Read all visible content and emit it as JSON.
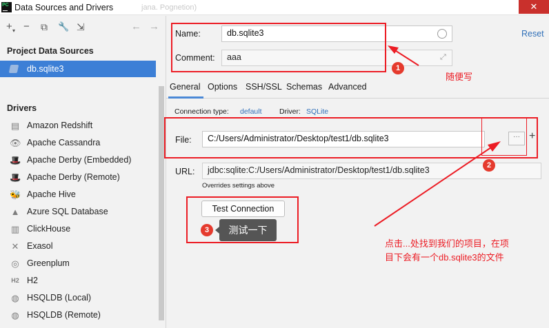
{
  "window": {
    "title": "Data Sources and Drivers",
    "ghost_text": "jana. Pognetion)",
    "close_glyph": "✕",
    "logo_text": "PC"
  },
  "toolbar": {
    "add": "+",
    "add_caret": "▾",
    "remove": "−",
    "copy": "⧉",
    "settings": "🔧",
    "import": "⇲",
    "back": "←",
    "forward": "→"
  },
  "left": {
    "project_header": "Project Data Sources",
    "project_item": "db.sqlite3",
    "drivers_header": "Drivers",
    "drivers": [
      {
        "label": "Amazon Redshift",
        "icon": "▤"
      },
      {
        "label": "Apache Cassandra",
        "icon": "👁"
      },
      {
        "label": "Apache Derby (Embedded)",
        "icon": "🎩"
      },
      {
        "label": "Apache Derby (Remote)",
        "icon": "🎩"
      },
      {
        "label": "Apache Hive",
        "icon": "🐝"
      },
      {
        "label": "Azure SQL Database",
        "icon": "▲"
      },
      {
        "label": "ClickHouse",
        "icon": "▥"
      },
      {
        "label": "Exasol",
        "icon": "✕"
      },
      {
        "label": "Greenplum",
        "icon": "◎"
      },
      {
        "label": "H2",
        "icon": "H2"
      },
      {
        "label": "HSQLDB (Local)",
        "icon": "◍"
      },
      {
        "label": "HSQLDB (Remote)",
        "icon": "◍"
      }
    ]
  },
  "form": {
    "name_label": "Name:",
    "name_value": "db.sqlite3",
    "comment_label": "Comment:",
    "comment_value": "aaa",
    "reset_label": "Reset",
    "tabs": [
      "General",
      "Options",
      "SSH/SSL",
      "Schemas",
      "Advanced"
    ],
    "connection_type_label": "Connection type:",
    "connection_type_value": "default",
    "driver_label": "Driver:",
    "driver_value": "SQLite",
    "file_label": "File:",
    "file_value": "C:/Users/Administrator/Desktop/test1/db.sqlite3",
    "dots_button": "···",
    "plus_button": "+",
    "url_label": "URL:",
    "url_value": "jdbc:sqlite:C:/Users/Administrator/Desktop/test1/db.sqlite3",
    "overrides_note": "Overrides settings above",
    "test_button": "Test Connection"
  },
  "annotations": {
    "badge1": "1",
    "badge2": "2",
    "badge3": "3",
    "note1": "随便写",
    "tooltip3": "测试一下",
    "note2_line1": "点击...处找到我们的项目，在项",
    "note2_line2": "目下会有一个db.sqlite3的文件",
    "red_color": "#ec1c24"
  }
}
